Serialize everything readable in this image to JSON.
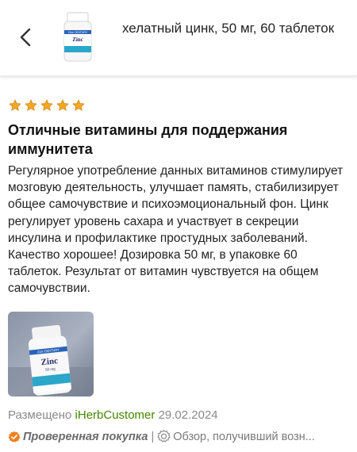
{
  "header": {
    "product_title": "хелатный цинк, 50 мг, 60 таблеток",
    "thumbnail": {
      "brand": "21st CENTURY",
      "label": "Zinc"
    }
  },
  "review": {
    "rating": 5,
    "star_color": "#f5a623",
    "title": "Отличные витамины для поддержания иммунитета",
    "body": "Регулярное употребление данных витаминов стимулирует мозговую деятельность, улучшает память, стабилизирует общее самочувствие и психоэмоциональный фон. Цинк регулирует уровень сахара и участвует в секреции инсулина и профилактике простудных заболеваний. Качество хорошее! Дозировка 50 мг, в упаковке 60 таблеток. Результат от витамин чувствуется на общем самочувствии.",
    "photo": {
      "brand": "21st CENTURY",
      "label": "Zinc",
      "dose": "50 mg"
    },
    "posted_prefix": "Размещено",
    "author": "iHerbCustomer",
    "date": "29.02.2024",
    "verified_label": "Проверенная покупка",
    "separator": "|",
    "incentive_label": "Обзор, получивший возн..."
  },
  "colors": {
    "accent_green": "#458500",
    "verified_badge": "#f0801e"
  }
}
